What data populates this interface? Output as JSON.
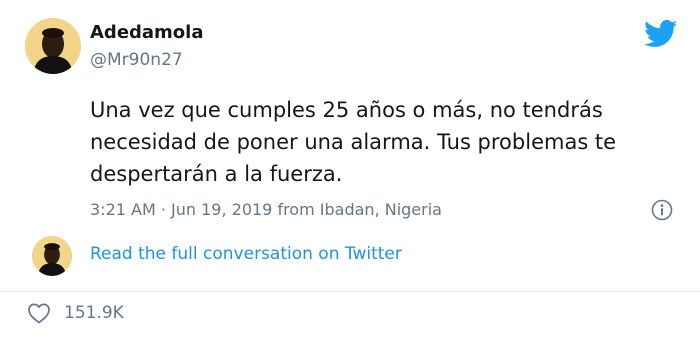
{
  "author": {
    "display_name": "Adedamola",
    "handle": "@Mr90n27"
  },
  "tweet": {
    "text": "Una vez que cumples 25 años o más, no tendrás necesidad de poner una alarma. Tus problemas te despertarán a la fuerza.",
    "meta": "3:21 AM · Jun 19, 2019 from Ibadan, Nigeria"
  },
  "actions": {
    "read_full": "Read the full conversation on Twitter",
    "like_count": "151.9K"
  },
  "icons": {
    "brand": "twitter-bird-icon",
    "info": "info-icon",
    "like": "heart-icon"
  },
  "colors": {
    "brand": "#1DA1F2",
    "link": "#1B95E0",
    "secondary_text": "#657786",
    "divider": "#E1E8ED"
  }
}
